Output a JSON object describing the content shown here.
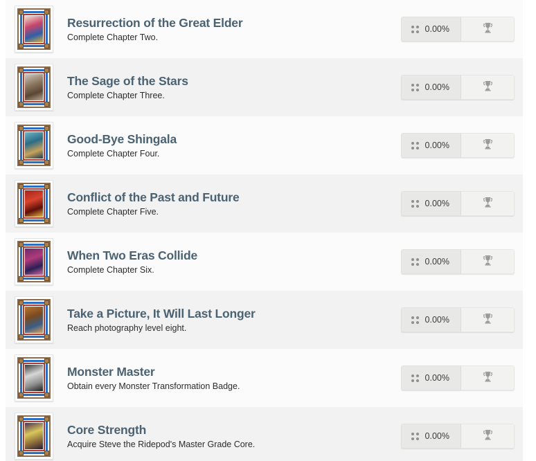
{
  "page": {
    "background": "#ffffff",
    "row_bg_odd": "#fbfbfb",
    "row_bg_even": "#f2f2f2",
    "title_color": "#4b6272",
    "desc_color": "#2b2b2b"
  },
  "controls": {
    "progress_icon": "dots-grid-icon",
    "trophy_icon": "trophy-icon"
  },
  "achievements": [
    {
      "title": "Resurrection of the Great Elder",
      "description": "Complete Chapter Two.",
      "progress": "0.00%",
      "icon": "framed-portrait-icon",
      "art_colors": [
        "#f0e2cf",
        "#c9456b",
        "#2f5fa8",
        "#d9b13f"
      ]
    },
    {
      "title": "The Sage of the Stars",
      "description": "Complete Chapter Three.",
      "progress": "0.00%",
      "icon": "framed-portrait-icon",
      "art_colors": [
        "#cfc7bd",
        "#8e7a62",
        "#5a4634",
        "#b8a88f"
      ]
    },
    {
      "title": "Good-Bye Shingala",
      "description": "Complete Chapter Four.",
      "progress": "0.00%",
      "icon": "framed-portrait-icon",
      "art_colors": [
        "#6fb4c9",
        "#2c6c86",
        "#c8a25a",
        "#1d3a4d"
      ]
    },
    {
      "title": "Conflict of the Past and Future",
      "description": "Complete Chapter Five.",
      "progress": "0.00%",
      "icon": "framed-portrait-icon",
      "art_colors": [
        "#a3241c",
        "#d8452c",
        "#5d0f0a",
        "#e8b33a"
      ]
    },
    {
      "title": "When Two Eras Collide",
      "description": "Complete Chapter Six.",
      "progress": "0.00%",
      "icon": "framed-portrait-icon",
      "art_colors": [
        "#6a2a6e",
        "#b03a7a",
        "#2b1f55",
        "#d16aa0"
      ]
    },
    {
      "title": "Take a Picture, It Will Last Longer",
      "description": "Reach photography level eight.",
      "progress": "0.00%",
      "icon": "vintage-camera-icon",
      "art_colors": [
        "#b9762f",
        "#7b4a21",
        "#3a5d86",
        "#d9a05a"
      ]
    },
    {
      "title": "Monster Master",
      "description": "Obtain every Monster Transformation Badge.",
      "progress": "0.00%",
      "icon": "badge-collection-icon",
      "art_colors": [
        "#3a3a3a",
        "#d7d7d7",
        "#8d8d8d",
        "#1e1e1e"
      ]
    },
    {
      "title": "Core Strength",
      "description": "Acquire Steve the Ridepod's Master Grade Core.",
      "progress": "0.00%",
      "icon": "robot-core-icon",
      "art_colors": [
        "#4b2f55",
        "#d8c75a",
        "#8a6a3a",
        "#2b1a33"
      ]
    }
  ]
}
